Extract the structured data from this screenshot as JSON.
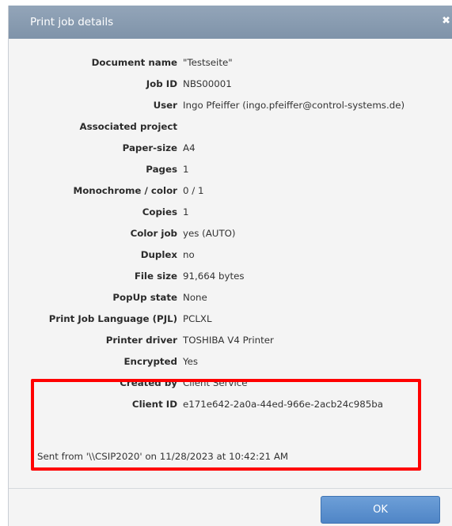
{
  "dialog": {
    "title": "Print job details",
    "close_glyph": "✖",
    "close_icon": "close-icon",
    "ok_label": "OK"
  },
  "details": [
    {
      "label": "Document name",
      "value": "\"Testseite\""
    },
    {
      "label": "Job ID",
      "value": "NBS00001"
    },
    {
      "label": "User",
      "value": "Ingo Pfeiffer (ingo.pfeiffer@control-systems.de)"
    },
    {
      "label": "Associated project",
      "value": ""
    },
    {
      "label": "Paper-size",
      "value": "A4"
    },
    {
      "label": "Pages",
      "value": "1"
    },
    {
      "label": "Monochrome / color",
      "value": "0 / 1"
    },
    {
      "label": "Copies",
      "value": "1"
    },
    {
      "label": "Color job",
      "value": "yes (AUTO)"
    },
    {
      "label": "Duplex",
      "value": "no"
    },
    {
      "label": "File size",
      "value": "91,664 bytes"
    },
    {
      "label": "PopUp state",
      "value": "None"
    },
    {
      "label": "Print Job Language (PJL)",
      "value": "PCLXL"
    },
    {
      "label": "Printer driver",
      "value": "TOSHIBA V4 Printer"
    },
    {
      "label": "Encrypted",
      "value": "Yes"
    },
    {
      "label": "Created by",
      "value": "Client Service"
    },
    {
      "label": "Client ID",
      "value": "e171e642-2a0a-44ed-966e-2acb24c985ba"
    }
  ],
  "sent_from": "Sent from '\\\\CSIP2020' on 11/28/2023 at 10:42:21 AM",
  "colors": {
    "titlebar": "#8a9db2",
    "highlight": "#ff0000",
    "ok_button": "#5b91cf"
  }
}
